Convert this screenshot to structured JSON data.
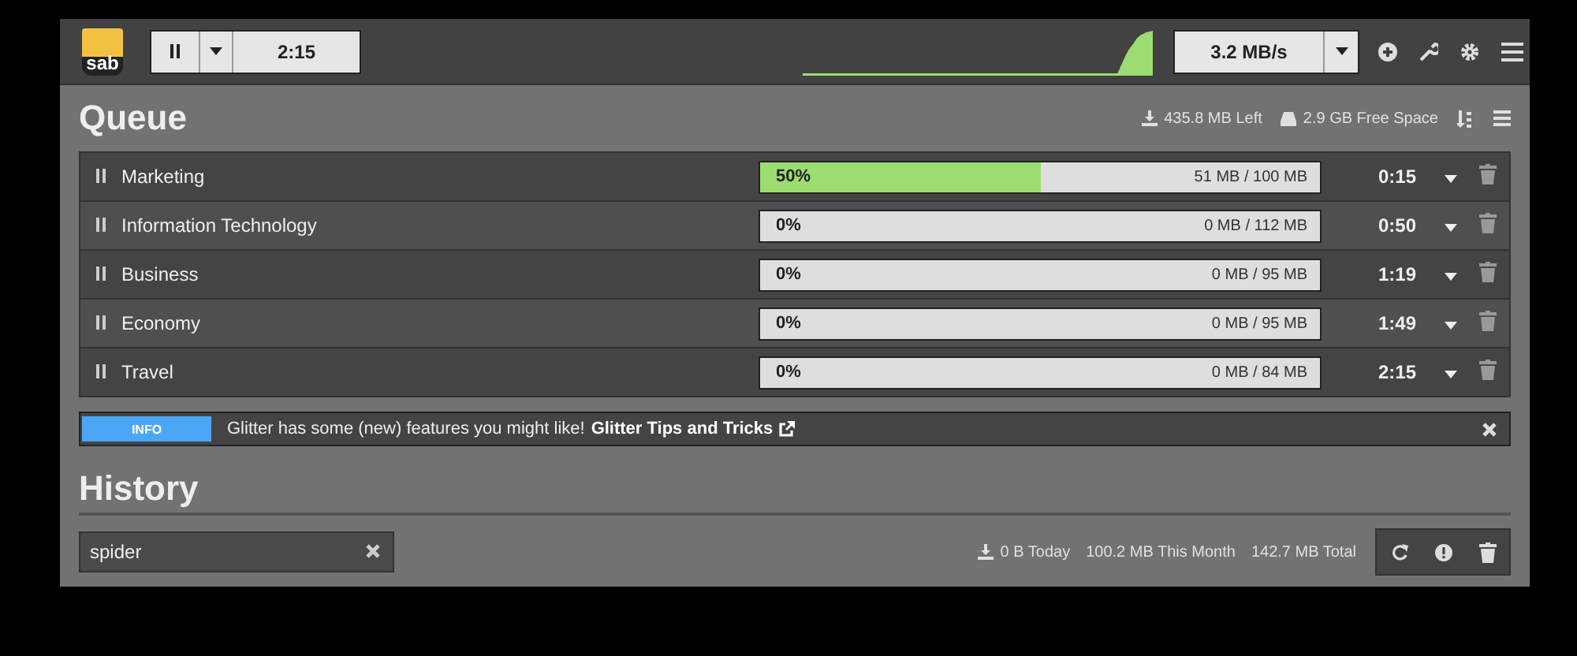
{
  "header": {
    "logo": "sab",
    "timer": "2:15",
    "speed": "3.2 MB/s"
  },
  "queue": {
    "title": "Queue",
    "left": "435.8 MB Left",
    "free_space": "2.9 GB Free Space",
    "rows": [
      {
        "name": "Marketing",
        "percent": "50%",
        "size": "51 MB / 100 MB",
        "level": 0.5,
        "time": "0:15"
      },
      {
        "name": "Information Technology",
        "percent": "0%",
        "size": "0 MB / 112 MB",
        "time": "0:50"
      },
      {
        "name": "Business",
        "percent": "0%",
        "size": "0 MB / 95 MB",
        "time": "1:19"
      },
      {
        "name": "Economy",
        "percent": "0%",
        "size": "0 MB / 95 MB",
        "time": "1:49"
      },
      {
        "name": "Travel",
        "percent": "0%",
        "size": "0 MB / 84 MB",
        "time": "2:15"
      }
    ]
  },
  "notice": {
    "label": "INFO",
    "message": "Glitter has some (new) features you might like!",
    "link": "Glitter Tips and Tricks"
  },
  "history": {
    "title": "History",
    "search": "spider",
    "today": "0 B Today",
    "month": "100.2 MB This Month",
    "total": "142.7 MB Total"
  }
}
